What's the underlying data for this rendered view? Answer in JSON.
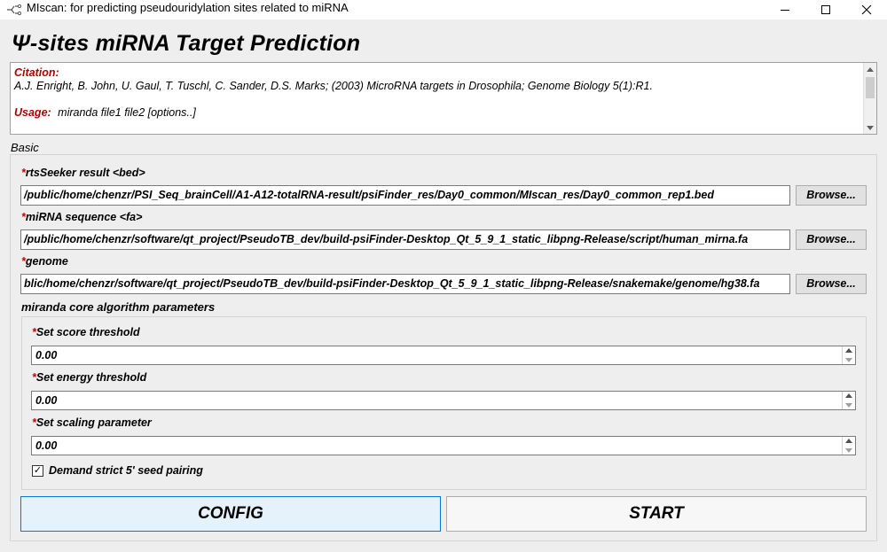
{
  "window": {
    "title": "MIscan: for predicting pseudouridylation sites related to miRNA"
  },
  "heading": "Ψ-sites miRNA Target Prediction",
  "info": {
    "citation_label": "Citation:",
    "citation_text": "A.J. Enright, B. John, U. Gaul, T. Tuschl, C. Sander, D.S. Marks; (2003) MicroRNA targets in Drosophila; Genome Biology 5(1):R1.",
    "usage_label": "Usage:",
    "usage_text": "miranda file1 file2 [options..]"
  },
  "basic": {
    "title": "Basic",
    "required_mark": "*",
    "bed": {
      "label": "rtsSeeker result <bed>",
      "value": "/public/home/chenzr/PSI_Seq_brainCell/A1-A12-totalRNA-result/psiFinder_res/Day0_common/MIscan_res/Day0_common_rep1.bed",
      "button": "Browse..."
    },
    "mirna": {
      "label": "miRNA sequence <fa>",
      "value": "/public/home/chenzr/software/qt_project/PseudoTB_dev/build-psiFinder-Desktop_Qt_5_9_1_static_libpng-Release/script/human_mirna.fa",
      "button": "Browse..."
    },
    "genome": {
      "label": "genome",
      "value": "blic/home/chenzr/software/qt_project/PseudoTB_dev/build-psiFinder-Desktop_Qt_5_9_1_static_libpng-Release/snakemake/genome/hg38.fa",
      "button": "Browse..."
    }
  },
  "algo": {
    "title": "miranda core algorithm parameters",
    "score": {
      "label": "Set score threshold",
      "value": "0.00"
    },
    "energy": {
      "label": "Set energy threshold",
      "value": "0.00"
    },
    "scaling": {
      "label": "Set scaling parameter",
      "value": "0.00"
    },
    "strict_seed": {
      "label": "Demand strict 5' seed pairing",
      "checked": true,
      "mark": "✓"
    }
  },
  "buttons": {
    "config": "CONFIG",
    "start": "START"
  }
}
